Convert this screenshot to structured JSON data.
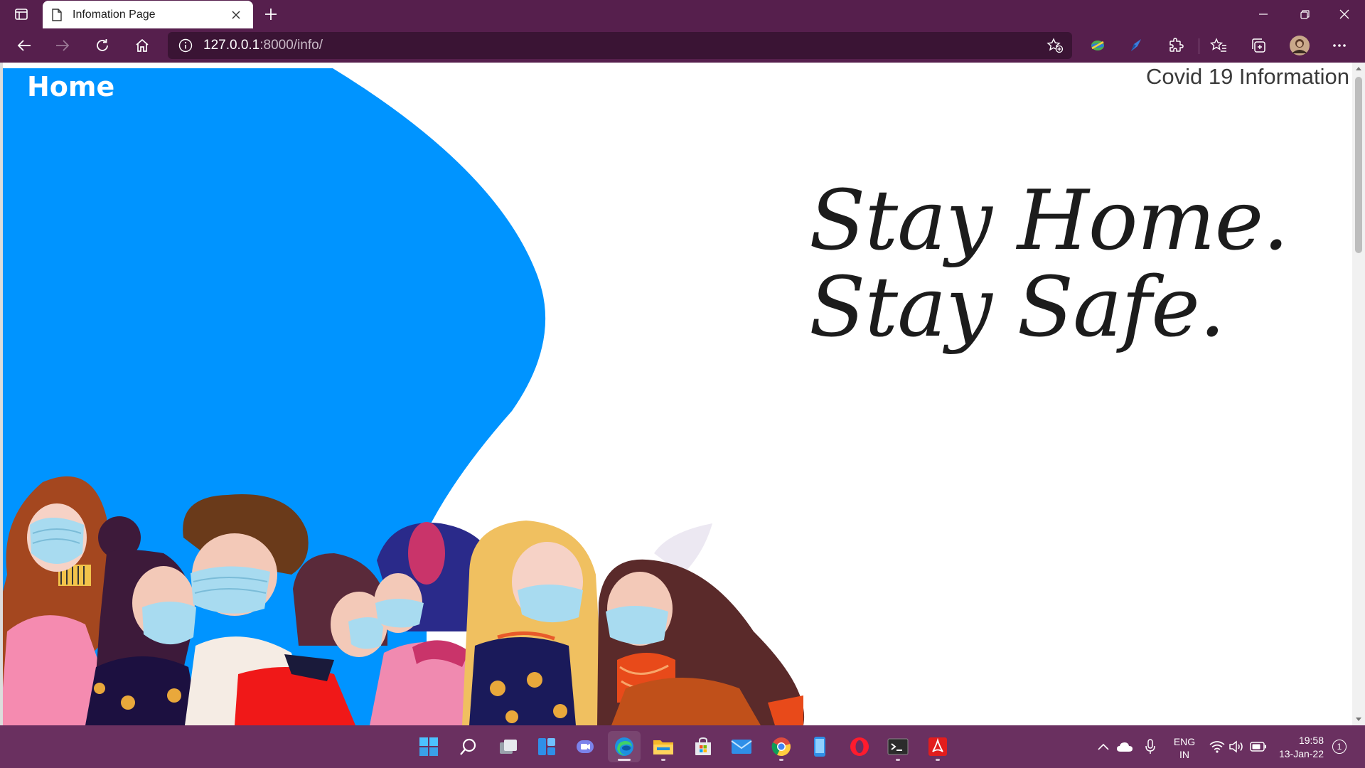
{
  "browser": {
    "tab_title": "Infomation Page",
    "url_host": "127.0.0.1",
    "url_rest": ":8000/info/",
    "theme_color": "#561f4d"
  },
  "page": {
    "home_link": "Home",
    "site_title": "Covid 19 Information",
    "slogan_line1": "Stay Home.",
    "slogan_line2": "Stay Safe.",
    "accent_color": "#0094ff",
    "illustration": "people-wearing-masks"
  },
  "taskbar": {
    "apps": [
      "start-icon",
      "search-icon",
      "task-view-icon",
      "widgets-icon",
      "teams-chat-icon",
      "edge-icon",
      "file-explorer-icon",
      "store-icon",
      "mail-icon",
      "chrome-icon",
      "phone-link-icon",
      "opera-icon",
      "terminal-icon",
      "acrobat-icon"
    ],
    "lang_line1": "ENG",
    "lang_line2": "IN",
    "time": "19:58",
    "date": "13-Jan-22",
    "notification_count": "1"
  }
}
